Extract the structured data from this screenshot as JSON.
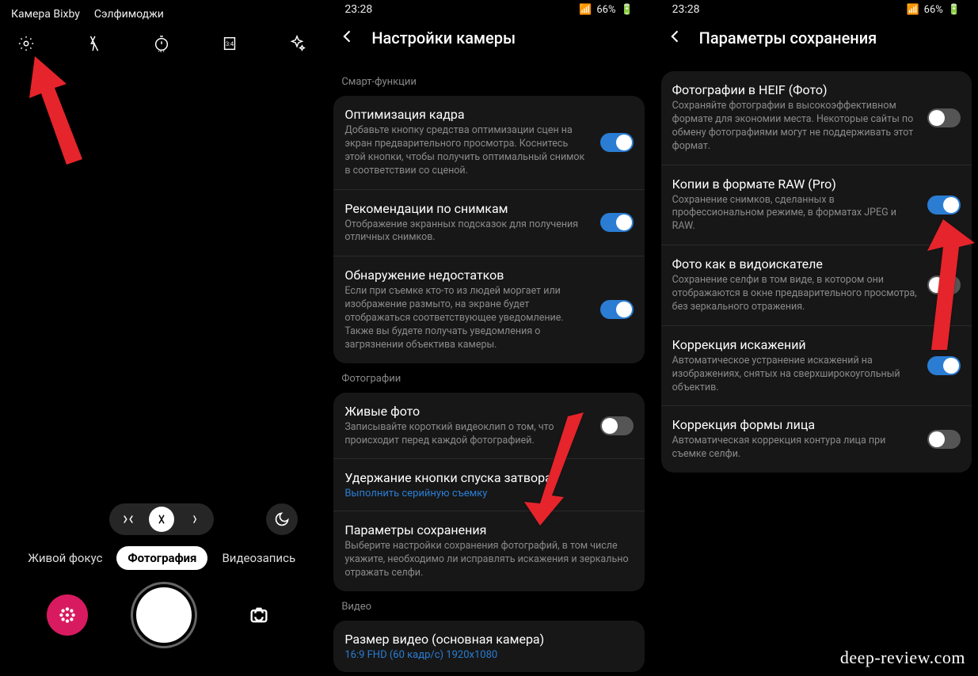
{
  "watermark": "deep-review.com",
  "screen1": {
    "topLabels": {
      "bixby": "Камера Bixby",
      "emoji": "Сэлфимоджи"
    },
    "modes": {
      "live": "Живой фокус",
      "photo": "Фотография",
      "video": "Видеозапись"
    }
  },
  "screen2": {
    "status": {
      "time": "23:28",
      "battery": "66%"
    },
    "title": "Настройки камеры",
    "sec1": "Смарт-функции",
    "r1": {
      "t": "Оптимизация кадра",
      "d": "Добавьте кнопку средства оптимизации сцен на экран предварительного просмотра. Коснитесь этой кнопки, чтобы получить оптимальный снимок в соответствии со сценой."
    },
    "r2": {
      "t": "Рекомендации по снимкам",
      "d": "Отображение экранных подсказок для получения отличных снимков."
    },
    "r3": {
      "t": "Обнаружение недостатков",
      "d": "Если при съемке кто-то из людей моргает или изображение размыто, на экране будет отображаться соответствующее уведомление. Также вы будете получать уведомления о загрязнении объектива камеры."
    },
    "sec2": "Фотографии",
    "r4": {
      "t": "Живые фото",
      "d": "Записывайте короткий видеоклип о том, что происходит перед каждой фотографией."
    },
    "r5": {
      "t": "Удержание кнопки спуска затвора",
      "l": "Выполнить серийную съемку"
    },
    "r6": {
      "t": "Параметры сохранения",
      "d": "Выберите настройки сохранения фотографий, в том числе укажите, необходимо ли исправлять искажения и зеркально отражать селфи."
    },
    "sec3": "Видео",
    "r7": {
      "t": "Размер видео (основная камера)",
      "l": "16:9 FHD (60 кадр/с) 1920x1080"
    }
  },
  "screen3": {
    "status": {
      "time": "23:28",
      "battery": "66%"
    },
    "title": "Параметры сохранения",
    "r1": {
      "t": "Фотографии в HEIF (Фото)",
      "d": "Сохраняйте фотографии в высокоэффективном формате для экономии места. Некоторые сайты по обмену фотографиями могут не поддерживать этот формат."
    },
    "r2": {
      "t": "Копии в формате RAW (Pro)",
      "d": "Сохранение снимков, сделанных в профессиональном режиме, в форматах JPEG и RAW."
    },
    "r3": {
      "t": "Фото как в видоискателе",
      "d": "Сохранение селфи в том виде, в котором они отображаются в окне предварительного просмотра, без зеркального отражения."
    },
    "r4": {
      "t": "Коррекция искажений",
      "d": "Автоматическое устранение искажений на изображениях, снятых на сверхширокоугольный объектив."
    },
    "r5": {
      "t": "Коррекция формы лица",
      "d": "Автоматическая коррекция контура лица при съемке селфи."
    }
  }
}
